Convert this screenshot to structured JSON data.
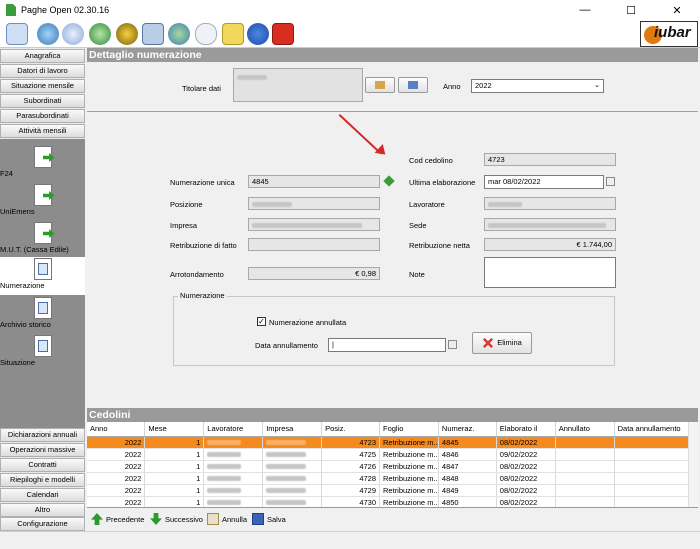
{
  "window": {
    "title": "Paghe Open 02.30.16"
  },
  "colors": {
    "accent": "#f58a1f",
    "header_bg": "#9a9a9a",
    "sidebar_panel": "#8c8c8c"
  },
  "toolbar": {
    "icons": [
      "home-icon",
      "globe-icon",
      "help-icon",
      "help-web-icon",
      "bug-icon",
      "network-icon",
      "refresh-globe-icon",
      "cloud-icon",
      "folder-icon",
      "info-icon",
      "close-red-icon"
    ],
    "logo_text": "iubar"
  },
  "sidebar": {
    "top_items": [
      "Anagrafica",
      "Datori di lavoro",
      "Situazione mensile",
      "Subordinati",
      "Parasubordinati",
      "Attività mensili"
    ],
    "tools": [
      "F24",
      "UniEmens",
      "M.U.T. (Cassa Edile)",
      "Numerazione",
      "Archivio storico",
      "Situazione"
    ],
    "bottom_items": [
      "Dichiarazioni annuali",
      "Operazioni massive",
      "Contratti",
      "Riepiloghi e modelli",
      "Calendari",
      "Altro",
      "Configurazione"
    ]
  },
  "detail": {
    "header": "Dettaglio numerazione",
    "titolare_label": "Titolare dati",
    "anno_label": "Anno",
    "anno_value": "2022",
    "cod_cedolino_label": "Cod cedolino",
    "cod_cedolino_value": "4723",
    "numerazione_unica_label": "Numerazione unica",
    "numerazione_unica_value": "4845",
    "ultima_elaborazione_label": "Ultima elaborazione",
    "ultima_elaborazione_value": "mar 08/02/2022",
    "posizione_label": "Posizione",
    "lavoratore_label": "Lavoratore",
    "impresa_label": "Impresa",
    "sede_label": "Sede",
    "retribuzione_fatto_label": "Retribuzione di fatto",
    "retribuzione_netta_label": "Retribuzione netta",
    "retribuzione_netta_value": "€ 1.744,00",
    "arrotondamento_label": "Arrotondamento",
    "arrotondamento_value": "€ 0,98",
    "note_label": "Note",
    "group_title": "Numerazione",
    "numerazione_annullata_label": "Numerazione annullata",
    "data_annullamento_label": "Data annullamento",
    "elimina_label": "Elimina"
  },
  "cedolini": {
    "header": "Cedolini",
    "columns": [
      "Anno",
      "Mese",
      "Lavoratore",
      "Impresa",
      "Posiz.",
      "Foglio",
      "Numeraz.",
      "Elaborato il",
      "Annullato",
      "Data annullamento"
    ],
    "rows": [
      {
        "anno": "2022",
        "mese": "1",
        "foglio_num": "4723",
        "foglio": "Retribuzione m...",
        "numeraz": "4845",
        "elaborato": "08/02/2022"
      },
      {
        "anno": "2022",
        "mese": "1",
        "foglio_num": "4725",
        "foglio": "Retribuzione m...",
        "numeraz": "4846",
        "elaborato": "09/02/2022"
      },
      {
        "anno": "2022",
        "mese": "1",
        "foglio_num": "4726",
        "foglio": "Retribuzione m...",
        "numeraz": "4847",
        "elaborato": "08/02/2022"
      },
      {
        "anno": "2022",
        "mese": "1",
        "foglio_num": "4728",
        "foglio": "Retribuzione m...",
        "numeraz": "4848",
        "elaborato": "08/02/2022"
      },
      {
        "anno": "2022",
        "mese": "1",
        "foglio_num": "4729",
        "foglio": "Retribuzione m...",
        "numeraz": "4849",
        "elaborato": "08/02/2022"
      },
      {
        "anno": "2022",
        "mese": "1",
        "foglio_num": "4730",
        "foglio": "Retribuzione m...",
        "numeraz": "4850",
        "elaborato": "08/02/2022"
      }
    ]
  },
  "bottom": {
    "precedente": "Precedente",
    "successivo": "Successivo",
    "annulla": "Annulla",
    "salva": "Salva"
  }
}
